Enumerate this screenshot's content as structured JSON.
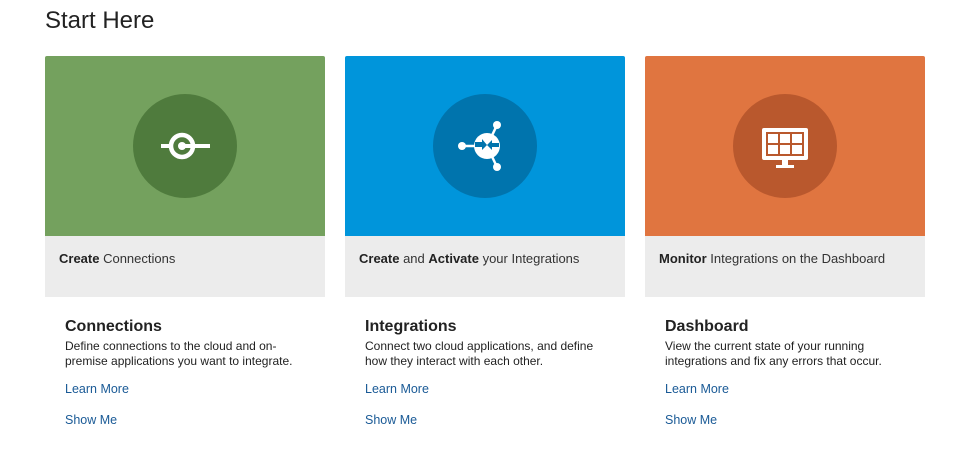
{
  "page": {
    "title": "Start Here"
  },
  "colors": {
    "connections_bg": "#74a15e",
    "connections_circle": "#4f7b3d",
    "integrations_bg": "#0095db",
    "integrations_circle": "#0074ad",
    "dashboard_bg": "#e07540",
    "dashboard_circle": "#b9582d",
    "link": "#1a5a96",
    "caption_bg": "#ececec"
  },
  "cards": [
    {
      "icon": "plug-connection-icon",
      "caption_bold": "Create",
      "caption_rest": " Connections",
      "heading": "Connections",
      "description": "Define connections to the cloud and on-premise applications you want to integrate.",
      "learn_more": "Learn More",
      "show_me": "Show Me"
    },
    {
      "icon": "integration-hub-icon",
      "caption_bold": "Create",
      "caption_mid": " and ",
      "caption_bold2": "Activate",
      "caption_rest": " your Integrations",
      "heading": "Integrations",
      "description": "Connect two cloud applications, and define how they interact with each other.",
      "learn_more": "Learn More",
      "show_me": "Show Me"
    },
    {
      "icon": "monitor-dashboard-icon",
      "caption_bold": "Monitor",
      "caption_rest": " Integrations on the Dashboard",
      "heading": "Dashboard",
      "description": "View the current state of your running integrations and fix any errors that occur.",
      "learn_more": "Learn More",
      "show_me": "Show Me"
    }
  ]
}
